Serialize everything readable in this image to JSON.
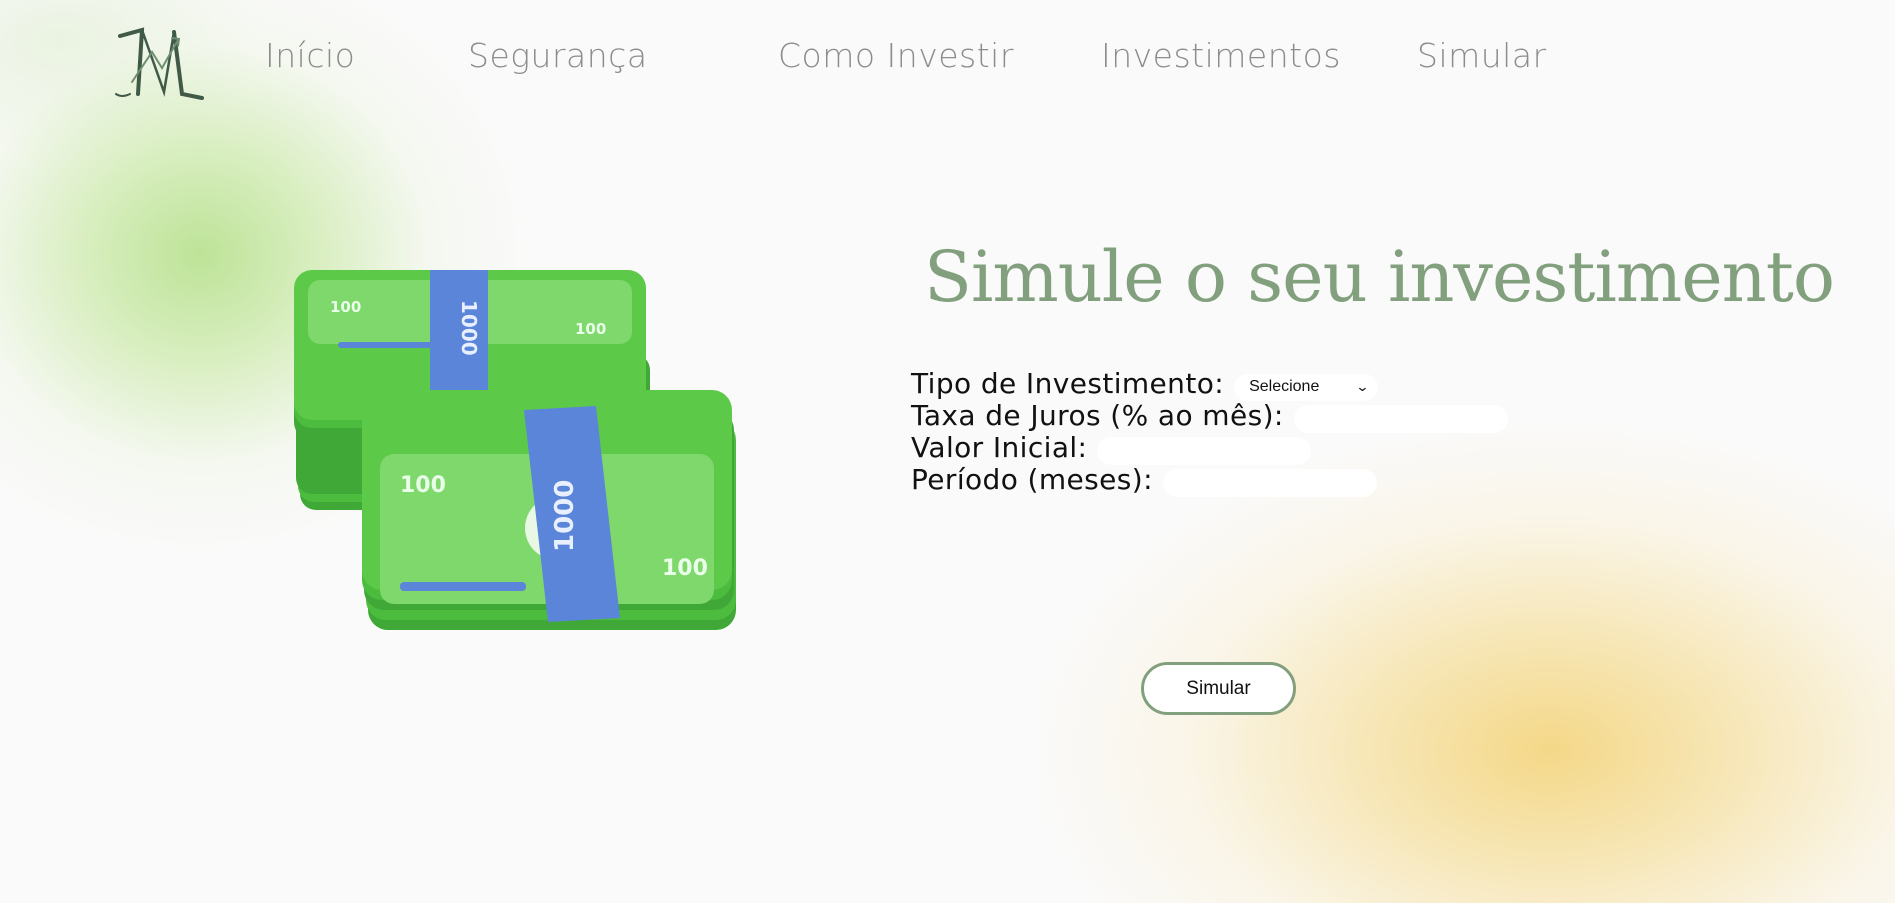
{
  "nav": {
    "items": [
      "Início",
      "Segurança",
      "Como Investir",
      "Investimentos",
      "Simular"
    ]
  },
  "logo": {
    "icon": "mn-monogram-logo"
  },
  "illustration": {
    "icon": "money-stacks-icon",
    "bill_value": "100",
    "band_value": "1000"
  },
  "heading": "Simule o seu investimento",
  "form": {
    "tipo_label": "Tipo de Investimento:",
    "tipo_selected": "Selecione",
    "taxa_label": "Taxa de Juros (% ao mês):",
    "valor_label": "Valor Inicial:",
    "periodo_label": "Período (meses):",
    "taxa_value": "",
    "valor_value": "",
    "periodo_value": ""
  },
  "button": {
    "label": "Simular"
  },
  "colors": {
    "accent": "#82a07d",
    "nav_text": "#8c8c8c",
    "bill_green": "#5cc948",
    "band_blue": "#5b85d8",
    "bg_green_glow": "#bae292",
    "bg_yellow_glow": "#f4d682"
  }
}
